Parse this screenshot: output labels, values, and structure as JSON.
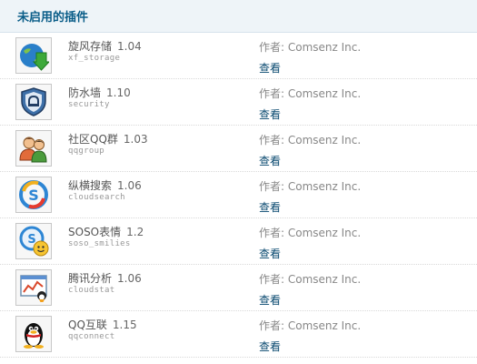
{
  "section": {
    "title": "未启用的插件"
  },
  "plugins": [
    {
      "name": "旋风存储",
      "version": "1.04",
      "id": "xf_storage",
      "author": "作者: Comsenz Inc.",
      "view_label": "查看",
      "icon": "storage-icon"
    },
    {
      "name": "防水墙",
      "version": "1.10",
      "id": "security",
      "author": "作者: Comsenz Inc.",
      "view_label": "查看",
      "icon": "shield-icon"
    },
    {
      "name": "社区QQ群",
      "version": "1.03",
      "id": "qqgroup",
      "author": "作者: Comsenz Inc.",
      "view_label": "查看",
      "icon": "users-icon"
    },
    {
      "name": "纵横搜索",
      "version": "1.06",
      "id": "cloudsearch",
      "author": "作者: Comsenz Inc.",
      "view_label": "查看",
      "icon": "search-icon"
    },
    {
      "name": "SOSO表情",
      "version": "1.2",
      "id": "soso_smilies",
      "author": "作者: Comsenz Inc.",
      "view_label": "查看",
      "icon": "smiley-search-icon"
    },
    {
      "name": "腾讯分析",
      "version": "1.06",
      "id": "cloudstat",
      "author": "作者: Comsenz Inc.",
      "view_label": "查看",
      "icon": "analytics-icon"
    },
    {
      "name": "QQ互联",
      "version": "1.15",
      "id": "qqconnect",
      "author": "作者: Comsenz Inc.",
      "view_label": "查看",
      "icon": "qq-penguin-icon"
    }
  ]
}
